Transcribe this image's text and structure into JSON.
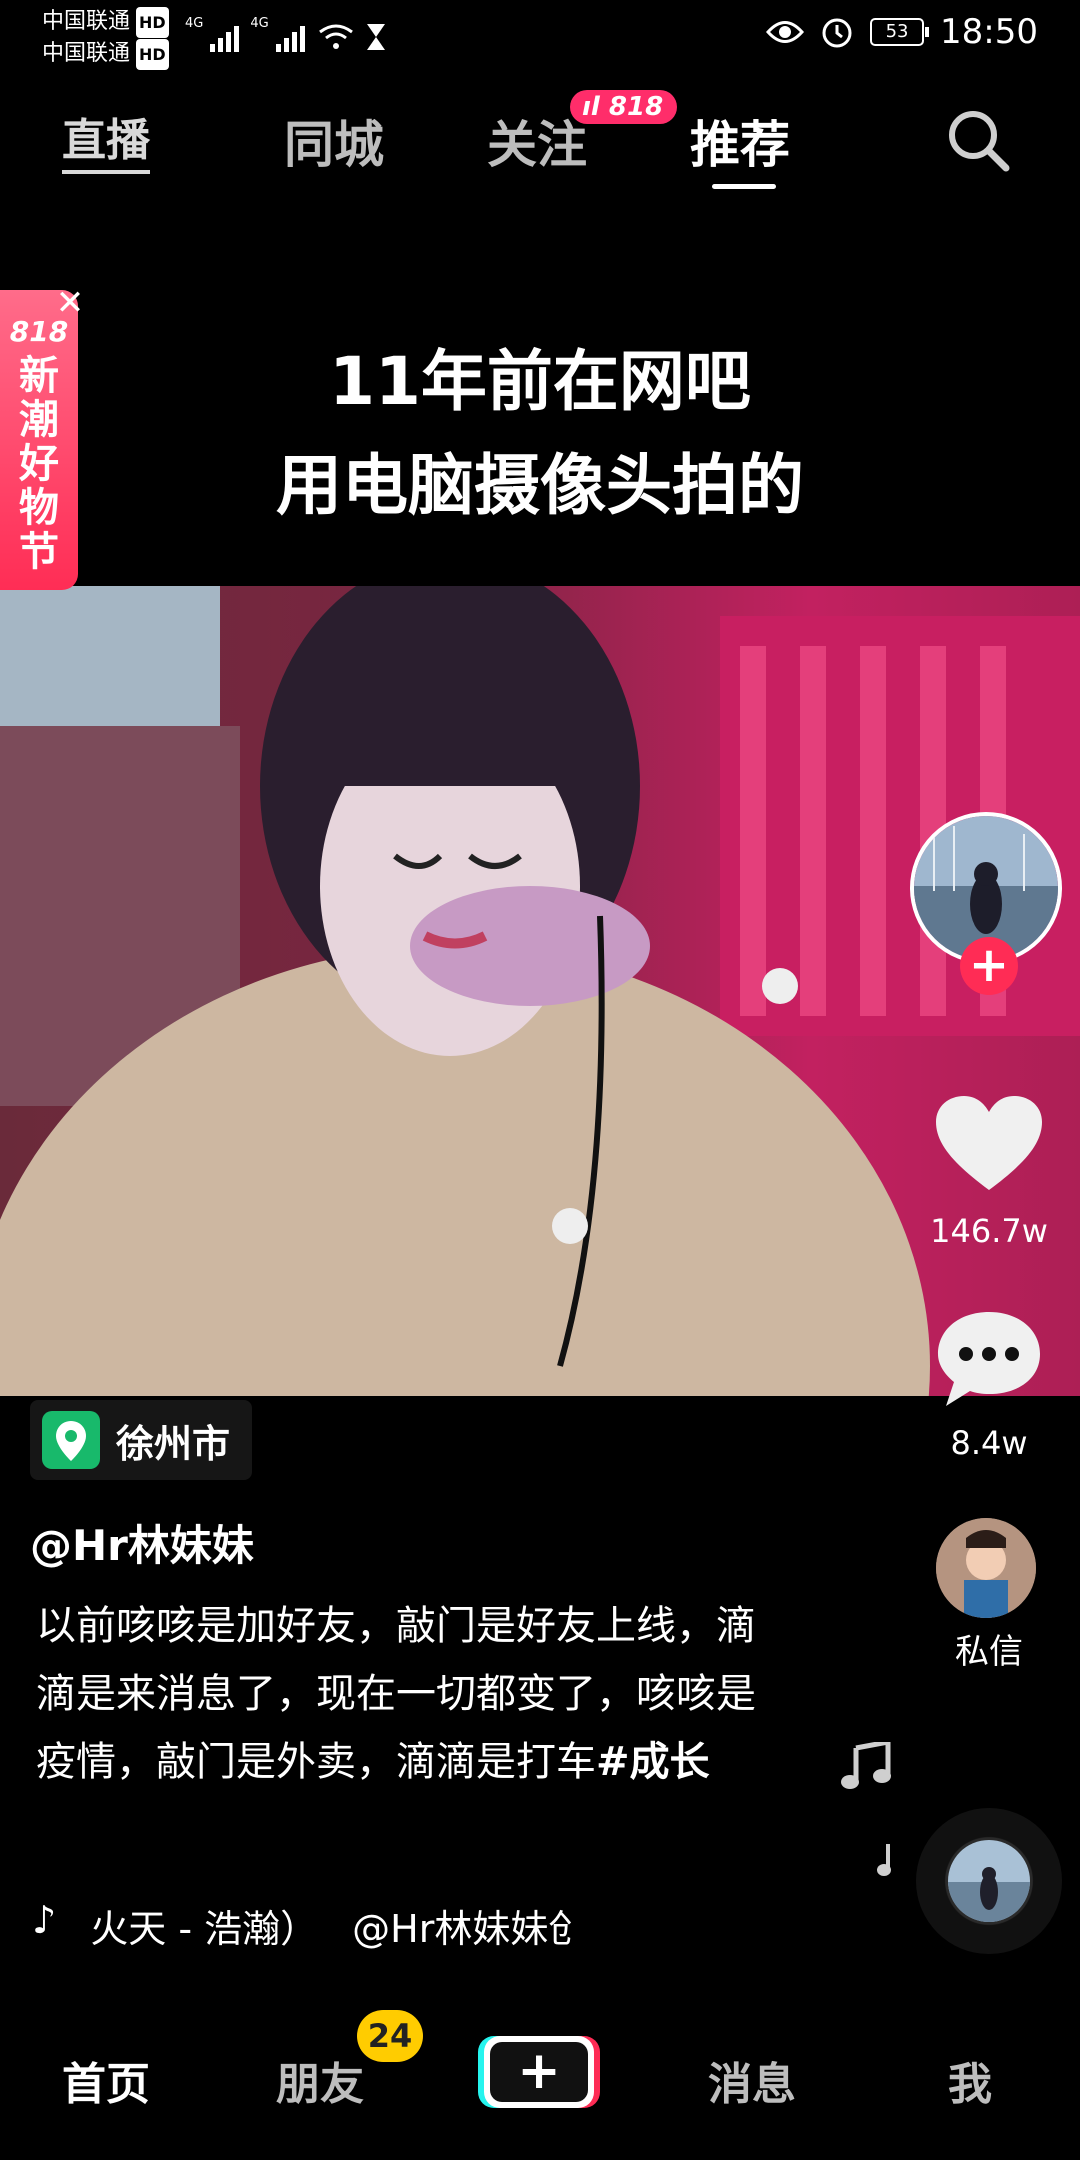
{
  "status_bar": {
    "carrier1": "中国联通",
    "carrier2": "中国联通",
    "hd": "HD",
    "network": "4G",
    "battery": "53",
    "time": "18:50"
  },
  "top_tabs": {
    "live": "直播",
    "city": "同城",
    "follow": "关注",
    "follow_badge": "818",
    "recommend": "推荐"
  },
  "promo": {
    "top": "818",
    "line1": "新",
    "line2": "潮",
    "line3": "好",
    "line4": "物",
    "line5": "节"
  },
  "video_caption": {
    "line1": "11年前在网吧",
    "line2": "用电脑摄像头拍的"
  },
  "stats": {
    "likes": "146.7w",
    "comments": "8.4w",
    "dm": "私信"
  },
  "location": "徐州市",
  "author": "@Hr林妹妹",
  "description": {
    "text": "以前咳咳是加好友，敲门是好友上线，滴滴是来消息了，现在一切都变了，咳咳是疫情，敲门是外卖，滴滴是打车",
    "tag": "#成长"
  },
  "music": {
    "title": "火天 - 浩瀚）",
    "author": "@Hr林妹妹创"
  },
  "bottom_nav": {
    "home": "首页",
    "friends": "朋友",
    "friends_badge": "24",
    "create": "+",
    "messages": "消息",
    "me": "我"
  },
  "colors": {
    "accent_red": "#ff2c55",
    "badge_yellow": "#ffcc00",
    "location_green": "#18b96b"
  }
}
